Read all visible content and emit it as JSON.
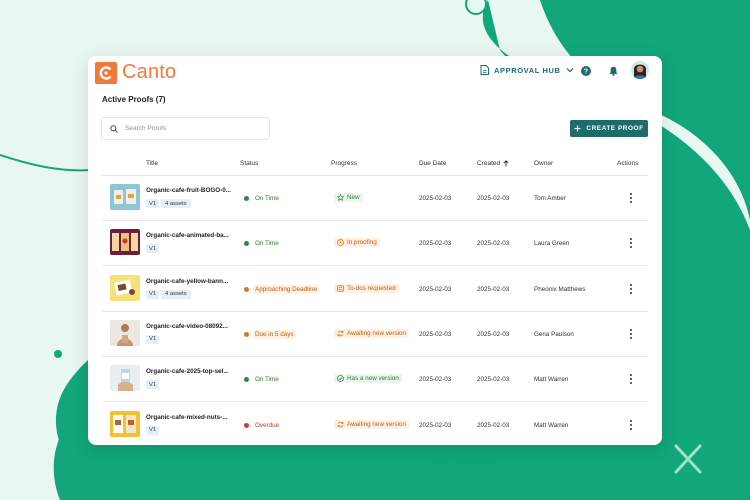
{
  "colors": {
    "brand_orange": "#f07a3a",
    "primary_teal": "#1e6b6b",
    "bg_green": "#12a67a",
    "bg_mint": "#e9f7f2",
    "green": "#2e8b3e",
    "orange": "#d9771f",
    "red": "#d63a2f"
  },
  "header": {
    "logo_text": "Canto",
    "approval_hub_label": "APPROVAL HUB",
    "icons": [
      "document-icon",
      "chevron-down-icon",
      "help-icon",
      "bell-icon",
      "avatar"
    ]
  },
  "page": {
    "title": "Active Proofs (7)"
  },
  "search": {
    "placeholder": "Search Proofs",
    "icon": "search-icon"
  },
  "toolbar": {
    "create_label": "CREATE PROOF",
    "create_icon": "plus-icon"
  },
  "table": {
    "columns": {
      "title": "Title",
      "status": "Status",
      "progress": "Progress",
      "due_date": "Due Date",
      "created": "Created",
      "owner": "Owner",
      "actions": "Actions"
    },
    "sort_icon": "arrow-up-icon",
    "rows": [
      {
        "title": "Organic-cafe-fruit-BOGO-0...",
        "version": "V1",
        "assets": "4 assets",
        "status": "On Time",
        "status_tone": "green",
        "progress": "New",
        "progress_icon": "star-icon",
        "progress_tone": "green",
        "due": "2025-02-03",
        "created": "2025-02-03",
        "owner": "Tom Amber",
        "thumb": "bags"
      },
      {
        "title": "Organic-cafe-animated-ba...",
        "version": "V1",
        "assets": "",
        "status": "On Time",
        "status_tone": "green",
        "progress": "In proofing",
        "progress_icon": "clock-icon",
        "progress_tone": "orange",
        "due": "2025-02-03",
        "created": "2025-02-03",
        "owner": "Laura Green",
        "thumb": "banner"
      },
      {
        "title": "Organic-cafe-yellow-bann...",
        "version": "V1",
        "assets": "4 assets",
        "status": "Approaching Deadline",
        "status_tone": "orange",
        "progress": "To-dos requested",
        "progress_icon": "list-icon",
        "progress_tone": "orange",
        "due": "2025-02-03",
        "created": "2025-02-03",
        "owner": "Pheonix Matthews",
        "thumb": "yellow"
      },
      {
        "title": "Organic-cafe-video-08092...",
        "version": "V1",
        "assets": "",
        "status": "Due in 5 days",
        "status_tone": "orange",
        "progress": "Awaiting new version",
        "progress_icon": "sync-icon",
        "progress_tone": "orange",
        "due": "2025-02-03",
        "created": "2025-02-03",
        "owner": "Gena Paulson",
        "thumb": "person"
      },
      {
        "title": "Organic-cafe-2025-top-sel...",
        "version": "V1",
        "assets": "",
        "status": "On Time",
        "status_tone": "green",
        "progress": "Has a new version",
        "progress_icon": "check-circle-icon",
        "progress_tone": "green",
        "due": "2025-02-03",
        "created": "2025-02-03",
        "owner": "Matt Warren",
        "thumb": "hand"
      },
      {
        "title": "Organic-cafe-mixed-nuts-...",
        "version": "V1",
        "assets": "",
        "status": "Overdue",
        "status_tone": "red",
        "progress": "Awaiting new version",
        "progress_icon": "sync-icon",
        "progress_tone": "orange",
        "due": "2025-02-03",
        "created": "2025-02-03",
        "owner": "Matt Warren",
        "thumb": "nuts"
      }
    ]
  }
}
